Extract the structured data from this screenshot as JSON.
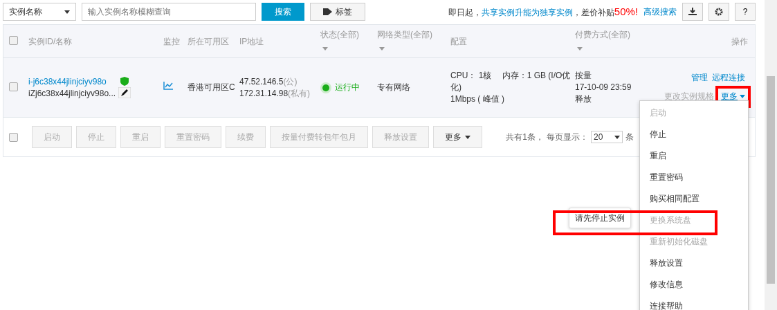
{
  "toolbar": {
    "filter_select": "实例名称",
    "search_placeholder": "输入实例名称模糊查询",
    "search_button": "搜索",
    "tag_button": "标签",
    "notice": [
      {
        "kind": "plain",
        "text": "即日起，"
      },
      {
        "kind": "link",
        "text": "共享实例"
      },
      {
        "kind": "link",
        "text": "升能为"
      },
      {
        "kind": "link",
        "text": "独享实例"
      },
      {
        "kind": "plain",
        "text": "，差价补贴"
      },
      {
        "kind": "alert",
        "text": "50%!"
      }
    ],
    "advanced_search": "高级搜索",
    "help_button": "?"
  },
  "table": {
    "select_all_checked": false,
    "columns": [
      {
        "label": "实例ID/名称",
        "filter": false
      },
      {
        "label": "监控",
        "filter": false
      },
      {
        "label": "所在可用区",
        "filter": false
      },
      {
        "label": "IP地址",
        "filter": false
      },
      {
        "label": "状态(全部)",
        "filter": true
      },
      {
        "label": "网络类型(全部)",
        "filter": true
      },
      {
        "label": "配置",
        "filter": false
      },
      {
        "label": "付费方式(全部)",
        "filter": true
      },
      {
        "label": "操作",
        "filter": false
      }
    ],
    "rows": [
      {
        "checked": false,
        "id": "i-j6c38x44jlinjciyv98o",
        "name": "iZj6c38x44jlinjciyv98o...",
        "zone": "香港可用区C",
        "ip_public": "47.52.146.5",
        "ip_public_tag": "(公)",
        "ip_private": "172.31.14.98",
        "ip_private_tag": "(私有)",
        "status": {
          "text": "运行中",
          "color": "#1aad19"
        },
        "network": "专有网络",
        "config": [
          "CPU： 1核　 内存：1 GB (I/O优化)",
          "1Mbps ( 峰值 )"
        ],
        "payment": "按量",
        "release_time": "17-10-09 23:59释放",
        "actions": [
          {
            "label": "管理",
            "enabled": true
          },
          {
            "label": "远程连接",
            "enabled": true
          },
          {
            "label": "更改实例规格",
            "enabled": false
          }
        ],
        "more": "更多"
      }
    ]
  },
  "batch_actions": [
    {
      "label": "启动",
      "enabled": false
    },
    {
      "label": "停止",
      "enabled": false
    },
    {
      "label": "重启",
      "enabled": false
    },
    {
      "label": "重置密码",
      "enabled": false
    },
    {
      "label": "续费",
      "enabled": false
    },
    {
      "label": "按量付费转包年包月",
      "enabled": false
    },
    {
      "label": "释放设置",
      "enabled": false
    },
    {
      "label": "更多",
      "enabled": true
    }
  ],
  "pagination": {
    "total": "共有1条，",
    "page_size_label": "每页显示：",
    "page_size": "20",
    "unit": "条"
  },
  "more_menu": [
    {
      "label": "启动",
      "enabled": false
    },
    {
      "label": "停止",
      "enabled": true
    },
    {
      "label": "重启",
      "enabled": true
    },
    {
      "label": "重置密码",
      "enabled": true
    },
    {
      "label": "购买相同配置",
      "enabled": true
    },
    {
      "label": "更换系统盘",
      "enabled": false,
      "highlighted": true
    },
    {
      "label": "重新初始化磁盘",
      "enabled": false
    },
    {
      "label": "释放设置",
      "enabled": true
    },
    {
      "label": "修改信息",
      "enabled": true
    },
    {
      "label": "连接帮助",
      "enabled": true
    }
  ],
  "tooltip": "请先停止实例"
}
